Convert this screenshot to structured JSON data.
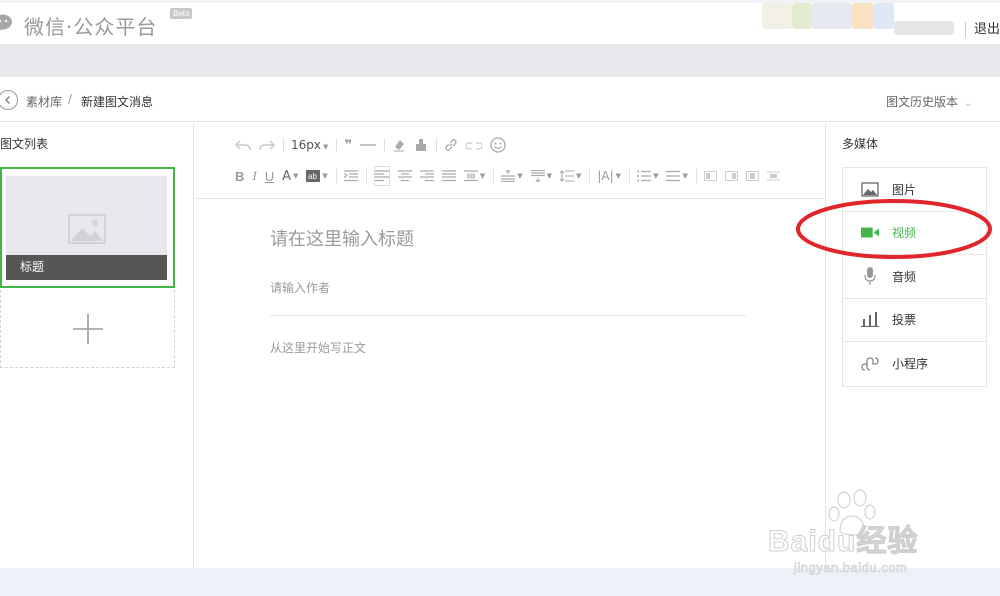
{
  "header": {
    "logo_text": "微信·公众平台",
    "beta_badge": "Beta",
    "logout_label": "退出",
    "brand_color": "#44b549"
  },
  "breadcrumb": {
    "parent": "素材库",
    "separator": "/",
    "current": "新建图文消息",
    "history_label": "图文历史版本"
  },
  "left_panel": {
    "title": "图文列表",
    "articles": [
      {
        "caption": "标题"
      }
    ],
    "add_icon": "plus-icon"
  },
  "toolbar": {
    "font_size": "16px",
    "row1_icons": [
      "undo-icon",
      "redo-icon",
      "font-size-select",
      "quote-icon",
      "horizontal-rule-icon",
      "clear-format-icon",
      "format-painter-icon",
      "link-icon",
      "unlink-icon",
      "emoji-icon"
    ],
    "row2_icons": [
      "bold-icon",
      "italic-icon",
      "underline-icon",
      "font-color-icon",
      "background-color-icon",
      "indent-icon",
      "align-left-icon",
      "align-center-icon",
      "align-right-icon",
      "justify-icon",
      "image-float-icon",
      "row-spacing-top-icon",
      "row-spacing-bottom-icon",
      "line-height-icon",
      "letter-spacing-icon",
      "list-icon",
      "list-ordered-icon",
      "table-icon-1",
      "table-icon-2",
      "table-icon-3",
      "table-icon-4"
    ],
    "bold": "B",
    "italic": "I",
    "underline": "U",
    "font_color": "A",
    "letter_spacing": "|A|"
  },
  "editor": {
    "title_placeholder": "请在这里输入标题",
    "author_placeholder": "请输入作者",
    "body_placeholder": "从这里开始写正文"
  },
  "media_panel": {
    "title": "多媒体",
    "items": [
      {
        "label": "图片",
        "icon": "image-icon",
        "active": false
      },
      {
        "label": "视频",
        "icon": "video-icon",
        "active": true
      },
      {
        "label": "音频",
        "icon": "microphone-icon",
        "active": false
      },
      {
        "label": "投票",
        "icon": "bar-chart-icon",
        "active": false
      },
      {
        "label": "小程序",
        "icon": "mini-program-icon",
        "active": false
      }
    ],
    "highlight_color": "#e0262b"
  },
  "watermark": {
    "main": "Baidu经验",
    "sub": "jingyan.baidu.com"
  }
}
